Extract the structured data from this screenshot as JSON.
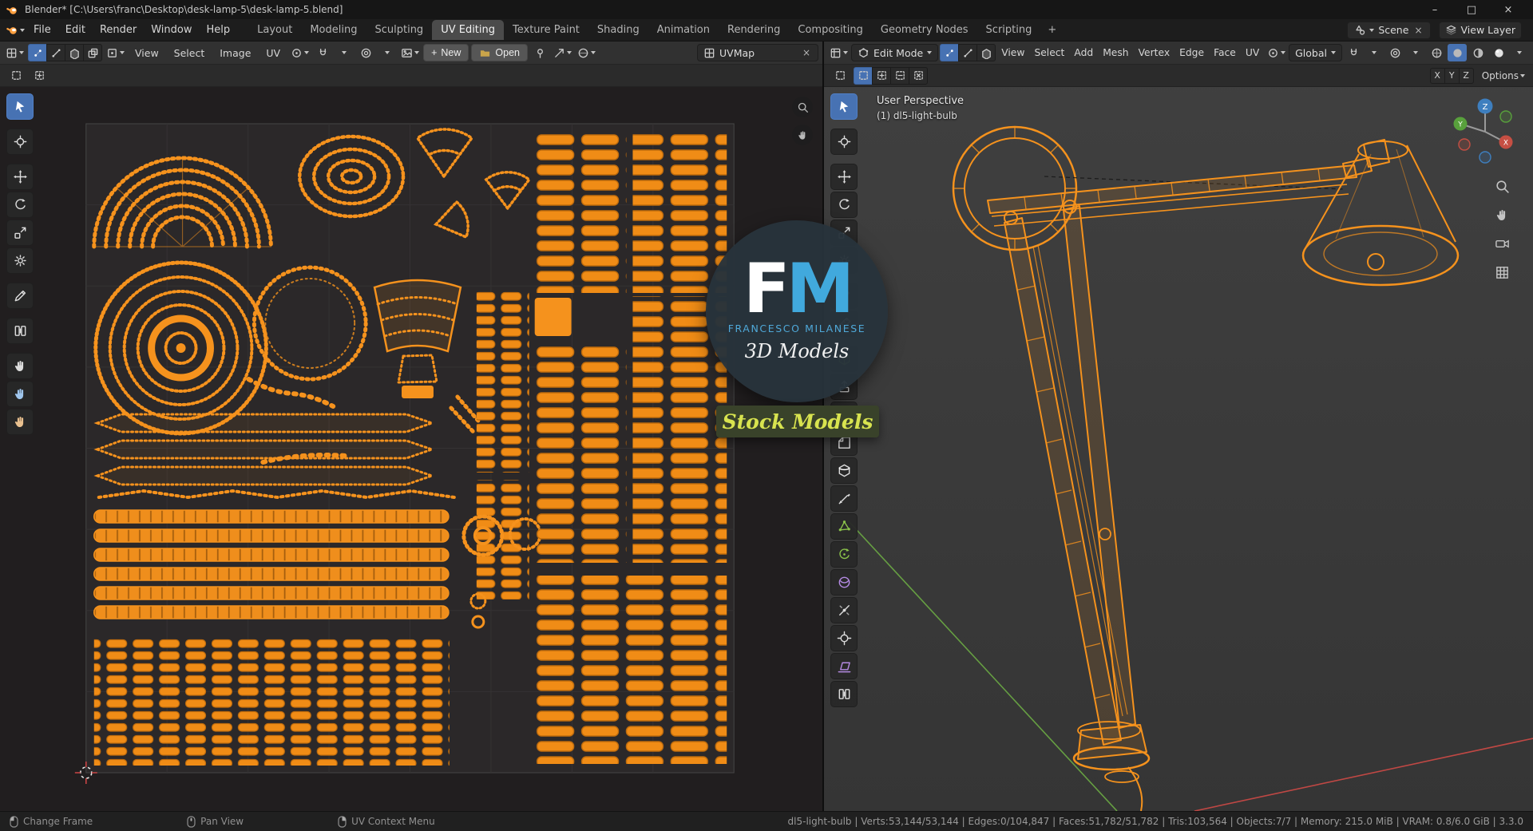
{
  "titlebar": {
    "title": "Blender* [C:\\Users\\franc\\Desktop\\desk-lamp-5\\desk-lamp-5.blend]"
  },
  "icons": {
    "minimize": "–",
    "maximize": "□",
    "close": "×",
    "new_plus": "+",
    "clear_x": "×"
  },
  "menubar": {
    "menus": [
      "File",
      "Edit",
      "Render",
      "Window",
      "Help"
    ],
    "workspaces": [
      "Layout",
      "Modeling",
      "Sculpting",
      "UV Editing",
      "Texture Paint",
      "Shading",
      "Animation",
      "Rendering",
      "Compositing",
      "Geometry Nodes",
      "Scripting"
    ],
    "active_workspace": "UV Editing",
    "add_workspace_label": "+",
    "scene_name": "Scene",
    "view_layer_name": "View Layer"
  },
  "uv_editor": {
    "menus": [
      "View",
      "Select",
      "Image",
      "UV"
    ],
    "new_button": "New",
    "open_button": "Open",
    "uv_map_name": "UVMap",
    "select_modes": [
      "vertex",
      "edge",
      "face",
      "island"
    ],
    "active_select_mode": "vertex",
    "header_icons": [
      "editor-type",
      "sticky-selection",
      "pivot",
      "snapping",
      "proportional-editing",
      "browse-image",
      "folder",
      "pin-image",
      "gizmos",
      "overlays"
    ],
    "tools": [
      "tweak-select",
      "cursor",
      "move",
      "rotate",
      "scale",
      "transform",
      "annotate",
      "rip-region",
      "grab",
      "relax",
      "pinch"
    ],
    "active_tool": "tweak-select"
  },
  "viewport_3d": {
    "mode": "Edit Mode",
    "menus": [
      "View",
      "Select",
      "Add",
      "Mesh",
      "Vertex",
      "Edge",
      "Face",
      "UV"
    ],
    "orientation": "Global",
    "options_label": "Options",
    "mirror_axes": [
      "X",
      "Y",
      "Z"
    ],
    "select_modes": [
      "vertex",
      "edge",
      "face"
    ],
    "active_select_mode": "vertex",
    "header_icons": [
      "editor-type",
      "edit-mode",
      "pivot",
      "snapping",
      "proportional-editing",
      "shading-wireframe",
      "shading-solid",
      "shading-material",
      "shading-rendered"
    ],
    "tools": [
      "tweak-select",
      "cursor",
      "move",
      "rotate",
      "scale",
      "transform",
      "annotate",
      "measure",
      "add-cube",
      "extrude-region",
      "inset-faces",
      "bevel",
      "loop-cut",
      "knife",
      "poly-build",
      "spin",
      "smooth",
      "edge-slide",
      "shrink-fatten",
      "shear",
      "rip-region"
    ],
    "active_tool": "tweak-select",
    "side_tools": [
      "zoom",
      "pan",
      "camera-view",
      "orthographic-grid"
    ],
    "overlay": {
      "view_name": "User Perspective",
      "active_object": "(1) dl5-light-bulb"
    },
    "gizmo_axes": {
      "x": "X",
      "y": "Y",
      "z": "Z"
    }
  },
  "watermark": {
    "initial_f": "F",
    "initial_m": "M",
    "author": "FRANCESCO MILANESE",
    "tagline": "3D Models",
    "badge": "Stock Models"
  },
  "statusbar": {
    "hints": [
      {
        "mouse_button": "left",
        "label": "Change Frame"
      },
      {
        "mouse_button": "middle",
        "label": "Pan View"
      },
      {
        "mouse_button": "right",
        "label": "UV Context Menu"
      }
    ],
    "stats": "dl5-light-bulb | Verts:53,144/53,144 | Edges:0/104,847 | Faces:51,782/51,782 | Tris:103,564 | Objects:7/7 | Memory: 215.0 MiB | VRAM: 0.8/6.0 GiB | 3.3.0"
  },
  "colors": {
    "accent_orange": "#f5921d",
    "selection_blue": "#4772b3",
    "logo_blue": "#41a9dd",
    "badge_bg": "#39422a",
    "badge_text": "#d8e34f",
    "axis_red": "#cf4a46",
    "axis_green": "#6cab44",
    "axis_blue": "#3e7fbf"
  }
}
